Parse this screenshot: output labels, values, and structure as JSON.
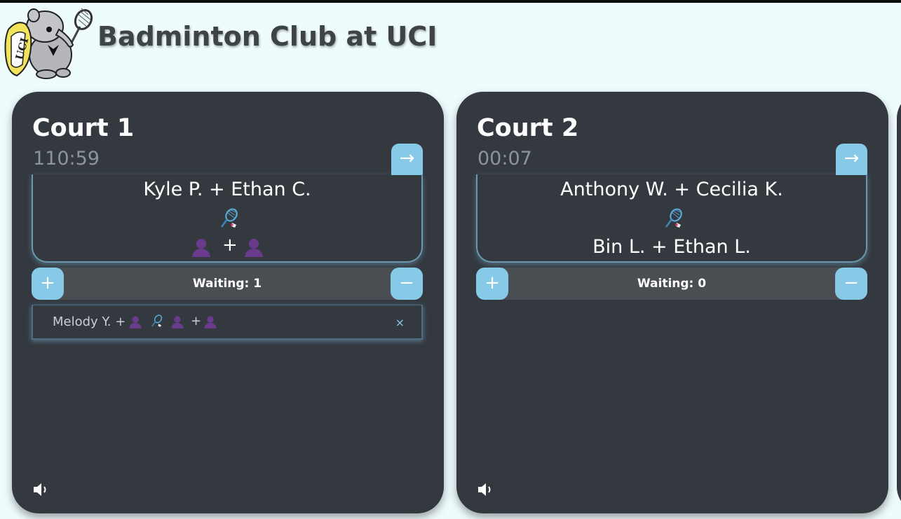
{
  "header": {
    "title": "Badminton Club at UCI",
    "logo_text": "UCI"
  },
  "courts": [
    {
      "name": "Court 1",
      "timer": "110:59",
      "next_label": "→",
      "team_a": "Kyle P. + Ethan C.",
      "team_b": "",
      "team_b_plus": "+",
      "waiting": {
        "add_label": "+",
        "remove_label": "−",
        "label": "Waiting: 1"
      },
      "queue": [
        {
          "text": "Melody Y. +",
          "plus": "+",
          "remove_label": "×"
        }
      ],
      "sound_icon": "speaker-icon"
    },
    {
      "name": "Court 2",
      "timer": "00:07",
      "next_label": "→",
      "team_a": "Anthony W. + Cecilia K.",
      "team_b": "Bin L. + Ethan L.",
      "waiting": {
        "add_label": "+",
        "remove_label": "−",
        "label": "Waiting: 0"
      },
      "queue": [],
      "sound_icon": "speaker-icon"
    }
  ],
  "colors": {
    "background": "#effcfe",
    "card": "#343940",
    "accent": "#86cae8",
    "empty_player": "#6a3b8c",
    "title": "#3e4348"
  }
}
